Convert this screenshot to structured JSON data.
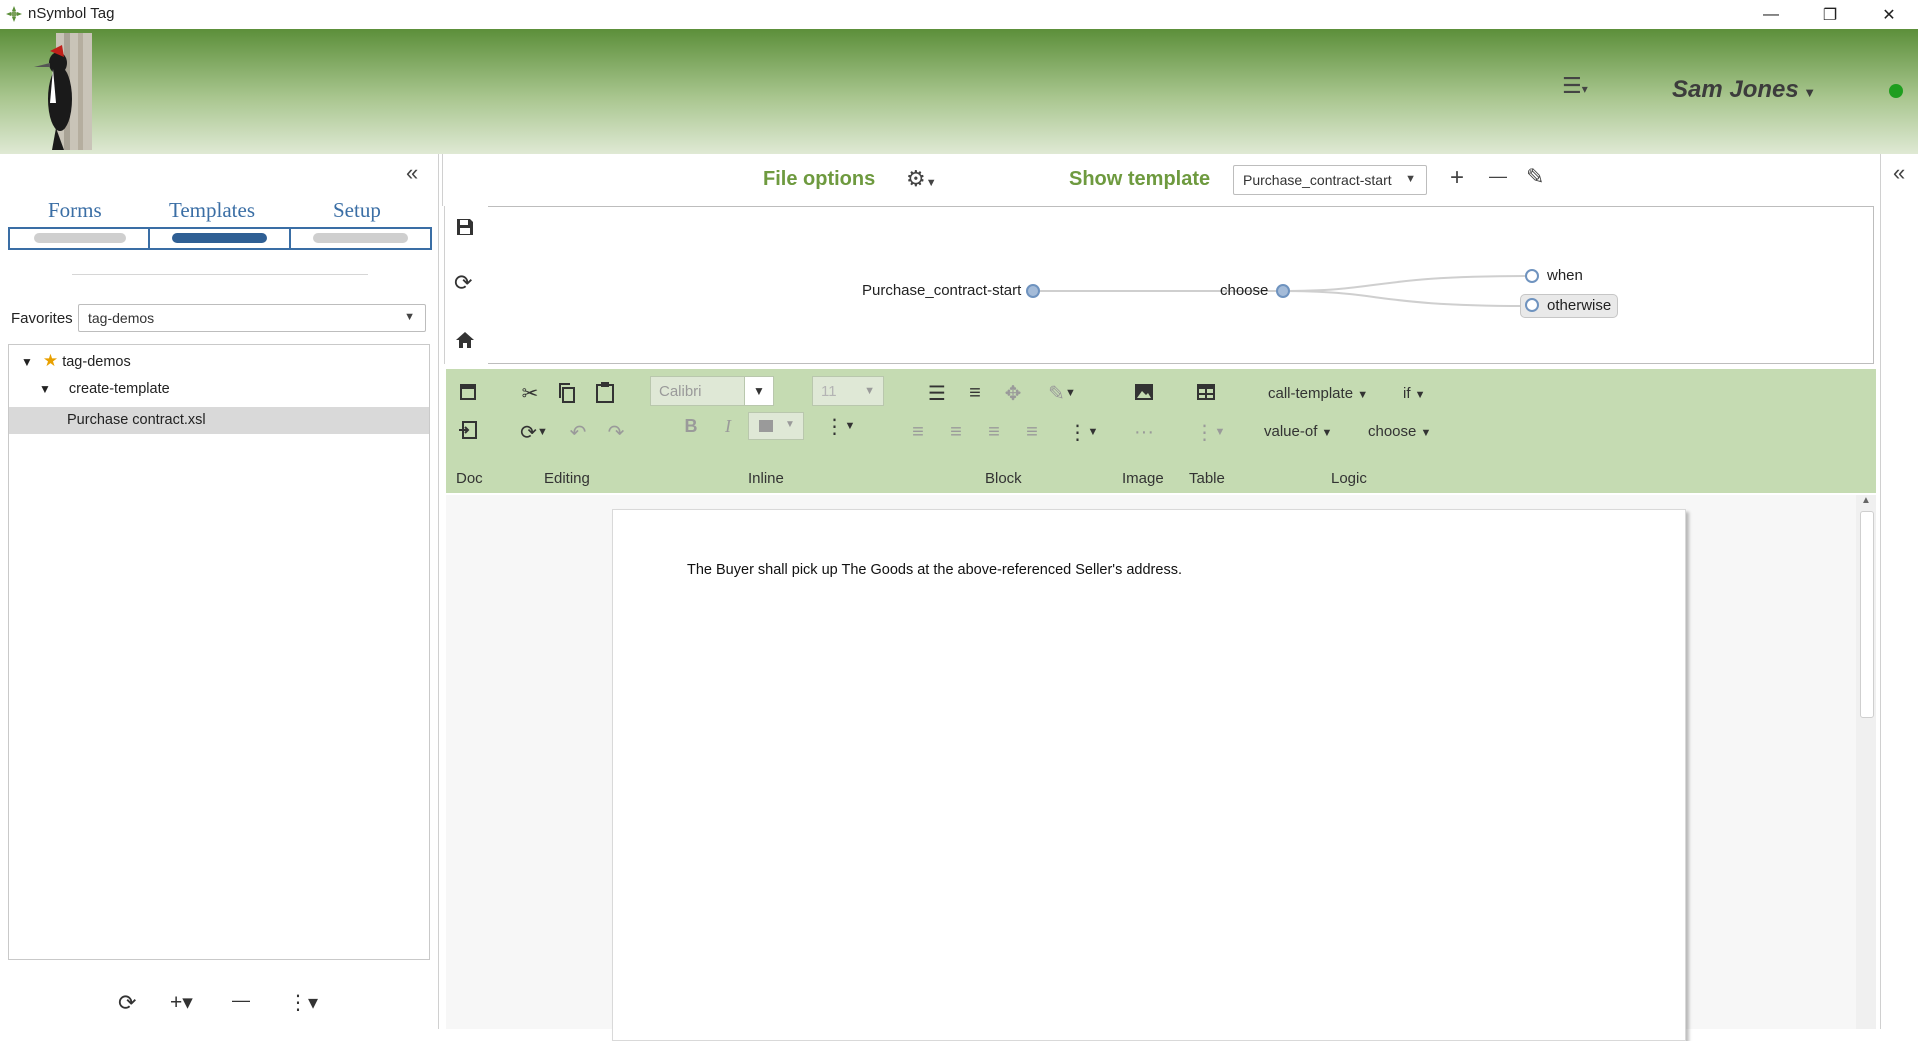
{
  "window": {
    "title": "nSymbol Tag",
    "minimize_glyph": "—",
    "maximize_glyph": "❐",
    "close_glyph": "✕"
  },
  "header": {
    "menu_icon": "hamburger-menu-icon",
    "user_name": "Sam Jones",
    "status_color": "#1f9e1f"
  },
  "left_panel": {
    "collapse_glyph": "«",
    "tabs": [
      {
        "label": "Forms",
        "active": false
      },
      {
        "label": "Templates",
        "active": true
      },
      {
        "label": "Setup",
        "active": false
      }
    ],
    "favorites_label": "Favorites",
    "favorites_value": "tag-demos",
    "tree": [
      {
        "label": "tag-demos",
        "level": 0,
        "expanded": true,
        "starred": true
      },
      {
        "label": "create-template",
        "level": 1,
        "expanded": true
      },
      {
        "label": "Purchase contract.xsl",
        "level": 2,
        "selected": true
      }
    ],
    "bottom_toolbar": {
      "refresh_glyph": "⟳",
      "add_glyph": "+▾",
      "remove_glyph": "—",
      "more_glyph": "⋮▾"
    }
  },
  "top_bar": {
    "file_options_label": "File options",
    "show_template_label": "Show template",
    "template_value": "Purchase_contract-start",
    "add_glyph": "+",
    "remove_glyph": "—",
    "edit_glyph": "✎"
  },
  "diagram": {
    "nodes": [
      "Purchase_contract-start",
      "choose",
      "when",
      "otherwise"
    ]
  },
  "ribbon": {
    "font_name": "Calibri",
    "font_size": "11",
    "bold_glyph": "B",
    "italic_glyph": "I",
    "dropdowns": {
      "call_template": "call-template",
      "if": "if",
      "value_of": "value-of",
      "choose": "choose"
    },
    "groups": {
      "doc": "Doc",
      "editing": "Editing",
      "inline": "Inline",
      "block": "Block",
      "image": "Image",
      "table": "Table",
      "logic": "Logic"
    },
    "ellipsis": "···"
  },
  "document": {
    "text": "The Buyer shall pick up The Goods at the above-referenced Seller's address."
  },
  "right_panel": {
    "collapse_glyph": "«"
  },
  "colors": {
    "accent_green": "#6e9a3f",
    "tab_blue": "#3a6ea5",
    "ribbon_green": "#c5dbb2"
  }
}
